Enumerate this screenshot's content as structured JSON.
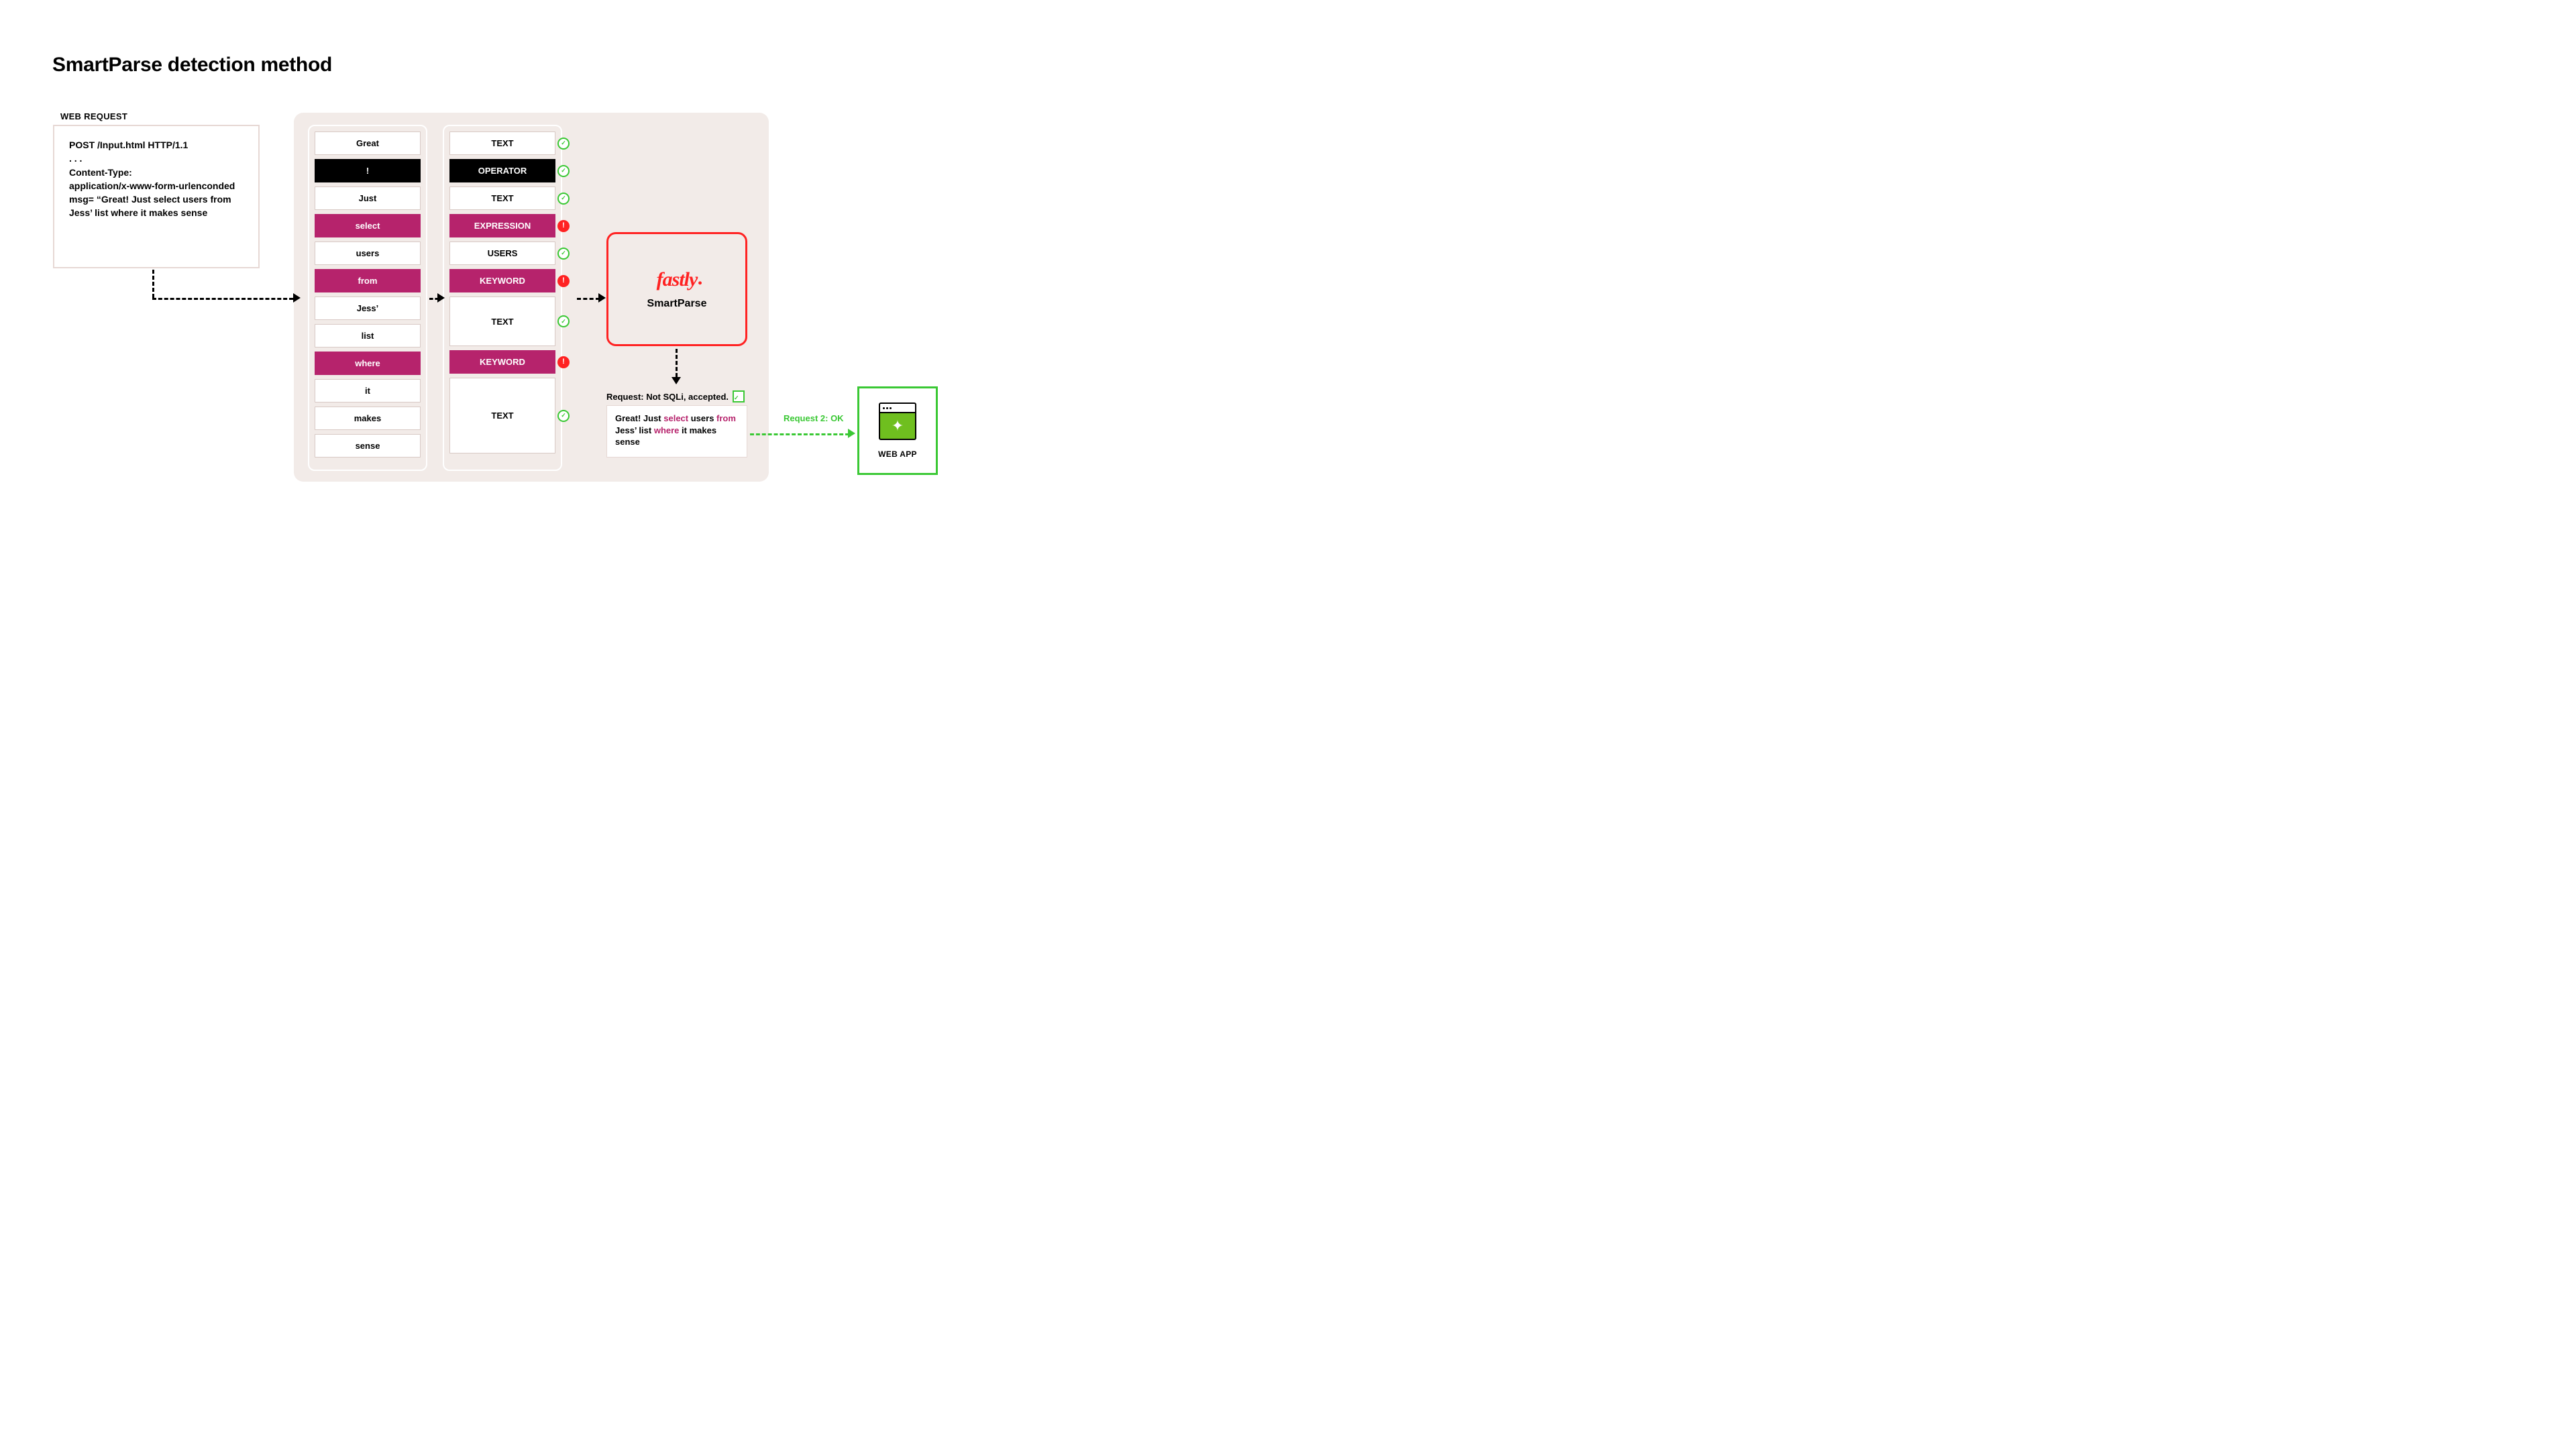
{
  "title": "SmartParse detection method",
  "webRequestLabel": "WEB REQUEST",
  "request": {
    "line1": "POST /Input.html HTTP/1.1",
    "line2": ". . .",
    "line3": "Content-Type:",
    "line4": "application/x-www-form-urlenconded",
    "blank": "",
    "line5": "msg= “Great! Just select users from Jess’ list where it makes sense"
  },
  "tokens": [
    {
      "word": "Great",
      "style": "plain"
    },
    {
      "word": "!",
      "style": "black"
    },
    {
      "word": "Just",
      "style": "plain"
    },
    {
      "word": "select",
      "style": "magenta"
    },
    {
      "word": "users",
      "style": "plain"
    },
    {
      "word": "from",
      "style": "magenta"
    },
    {
      "word": "Jess’",
      "style": "plain"
    },
    {
      "word": "list",
      "style": "plain"
    },
    {
      "word": "where",
      "style": "magenta"
    },
    {
      "word": "it",
      "style": "plain"
    },
    {
      "word": "makes",
      "style": "plain"
    },
    {
      "word": "sense",
      "style": "plain"
    }
  ],
  "classified": [
    {
      "label": "TEXT",
      "style": "plain",
      "mark": "ok",
      "span": 1
    },
    {
      "label": "OPERATOR",
      "style": "black",
      "mark": "ok",
      "span": 1
    },
    {
      "label": "TEXT",
      "style": "plain",
      "mark": "ok",
      "span": 1
    },
    {
      "label": "EXPRESSION",
      "style": "magenta",
      "mark": "warn",
      "span": 1
    },
    {
      "label": "USERS",
      "style": "plain",
      "mark": "ok",
      "span": 1
    },
    {
      "label": "KEYWORD",
      "style": "magenta",
      "mark": "warn",
      "span": 1
    },
    {
      "label": "TEXT",
      "style": "plain",
      "mark": "ok",
      "span": 2
    },
    {
      "label": "KEYWORD",
      "style": "magenta",
      "mark": "warn",
      "span": 1
    },
    {
      "label": "TEXT",
      "style": "plain",
      "mark": "ok",
      "span": 3
    }
  ],
  "fastly": {
    "logo": "fastly",
    "product": "SmartParse"
  },
  "verdict": "Request: Not SQLi, accepted.",
  "parsed": {
    "pre1": "Great! Just ",
    "kw1": "select",
    "mid1": " users ",
    "kw2": "from",
    "mid2": " Jess’ list ",
    "kw3": "where",
    "post": " it makes sense"
  },
  "request2": "Request 2: OK",
  "webapp": "WEB APP"
}
